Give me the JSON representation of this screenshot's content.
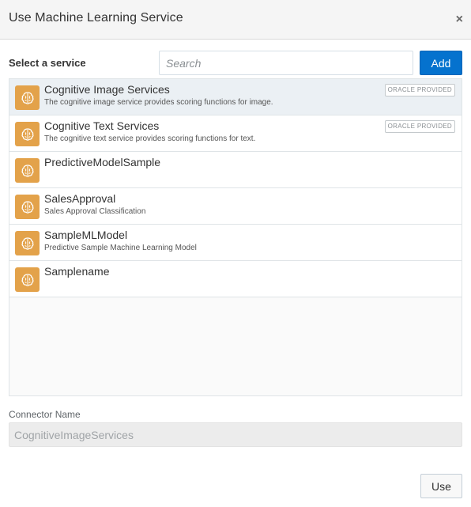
{
  "dialog": {
    "title": "Use Machine Learning Service",
    "close_glyph": "×"
  },
  "toolbar": {
    "select_label": "Select a service",
    "search_placeholder": "Search",
    "add_label": "Add"
  },
  "services": [
    {
      "name": "Cognitive Image Services",
      "description": "The cognitive image service provides scoring functions for image.",
      "badge": "ORACLE PROVIDED",
      "selected": true,
      "icon": "brain-icon"
    },
    {
      "name": "Cognitive Text Services",
      "description": "The cognitive text service provides scoring functions for text.",
      "badge": "ORACLE PROVIDED",
      "selected": false,
      "icon": "brain-icon"
    },
    {
      "name": "PredictiveModelSample",
      "description": "",
      "badge": "",
      "selected": false,
      "icon": "brain-icon"
    },
    {
      "name": "SalesApproval",
      "description": "Sales Approval Classification",
      "badge": "",
      "selected": false,
      "icon": "brain-icon"
    },
    {
      "name": "SampleMLModel",
      "description": "Predictive Sample Machine Learning Model",
      "badge": "",
      "selected": false,
      "icon": "brain-icon"
    },
    {
      "name": "Samplename",
      "description": "",
      "badge": "",
      "selected": false,
      "icon": "brain-icon"
    }
  ],
  "connector": {
    "label": "Connector Name",
    "value": "CognitiveImageServices"
  },
  "footer": {
    "use_label": "Use"
  },
  "colors": {
    "accent": "#0572ce",
    "icon_bg": "#e3a24a",
    "selected_row": "#ebf0f4"
  }
}
